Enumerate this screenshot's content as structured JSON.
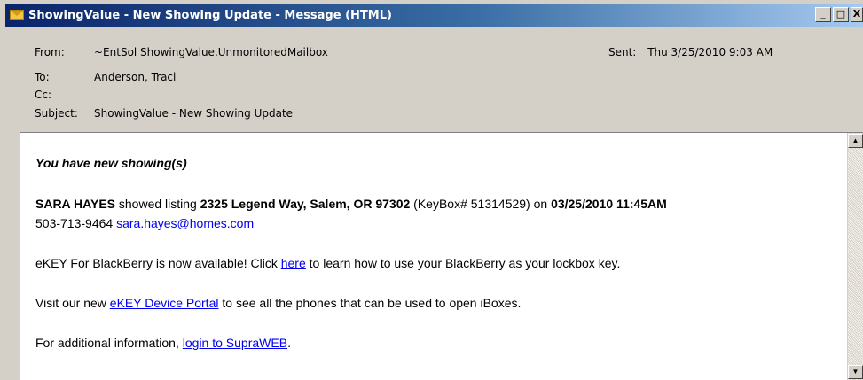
{
  "window": {
    "title": "ShowingValue - New Showing Update - Message (HTML)",
    "controls": {
      "minimize": "_",
      "maximize": "□",
      "close": "X"
    }
  },
  "header": {
    "from_label": "From:",
    "from_value": "~EntSol ShowingValue.UnmonitoredMailbox",
    "sent_label": "Sent:",
    "sent_value": "Thu 3/25/2010 9:03 AM",
    "to_label": "To:",
    "to_value": "Anderson, Traci",
    "cc_label": "Cc:",
    "cc_value": "",
    "subject_label": "Subject:",
    "subject_value": "ShowingValue - New Showing Update"
  },
  "message": {
    "notice": "You have new showing(s)",
    "agent_name": "SARA HAYES",
    "showed_listing": " showed listing ",
    "address": "2325 Legend Way, Salem, OR 97302",
    "keybox": " (KeyBox# 51314529) on ",
    "datetime": "03/25/2010 11:45AM",
    "phone": "503-713-9464 ",
    "email": "sara.hayes@homes.com",
    "ekey_pre": "eKEY For BlackBerry is now available! Click ",
    "ekey_link": "here",
    "ekey_post": " to learn how to use your BlackBerry as your lockbox key.",
    "portal_pre": "Visit our new ",
    "portal_link": "eKEY Device Portal",
    "portal_post": " to see all the phones that can be used to open iBoxes.",
    "info_pre": "For additional information, ",
    "info_link": "login to SupraWEB",
    "info_post": "."
  },
  "colors": {
    "link": "#0000ee",
    "titlebar_start": "#0a246a",
    "titlebar_end": "#a6caf0",
    "chrome": "#d4d0c8"
  },
  "icons": {
    "title_icon": "envelope-icon",
    "scroll_up": "arrow-up-icon",
    "scroll_down": "arrow-down-icon"
  }
}
